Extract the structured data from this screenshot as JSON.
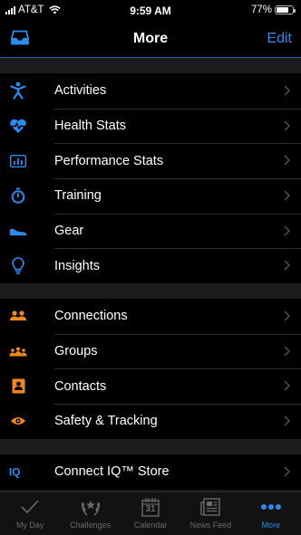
{
  "status_bar": {
    "carrier": "AT&T",
    "time": "9:59 AM",
    "battery": "77%",
    "battery_level": 0.77
  },
  "header": {
    "title": "More",
    "edit_label": "Edit"
  },
  "sections": [
    {
      "items": [
        {
          "label": "Activities",
          "icon": "figure-icon"
        },
        {
          "label": "Health Stats",
          "icon": "heart-pulse-icon"
        },
        {
          "label": "Performance Stats",
          "icon": "bar-chart-icon"
        },
        {
          "label": "Training",
          "icon": "stopwatch-icon"
        },
        {
          "label": "Gear",
          "icon": "shoe-icon"
        },
        {
          "label": "Insights",
          "icon": "lightbulb-icon"
        }
      ]
    },
    {
      "items": [
        {
          "label": "Connections",
          "icon": "people-icon"
        },
        {
          "label": "Groups",
          "icon": "group-icon"
        },
        {
          "label": "Contacts",
          "icon": "contact-card-icon"
        },
        {
          "label": "Safety & Tracking",
          "icon": "eye-icon"
        }
      ]
    },
    {
      "items": [
        {
          "label": "Connect IQ™ Store",
          "icon": "iq-icon"
        }
      ]
    }
  ],
  "tab_bar": {
    "tabs": [
      {
        "label": "My Day",
        "icon": "checkmark-icon",
        "active": false
      },
      {
        "label": "Challenges",
        "icon": "laurel-icon",
        "active": false
      },
      {
        "label": "Calendar",
        "icon": "calendar-icon",
        "active": false,
        "day": "31"
      },
      {
        "label": "News Feed",
        "icon": "newspaper-icon",
        "active": false
      },
      {
        "label": "More",
        "icon": "more-dots-icon",
        "active": true
      }
    ]
  },
  "colors": {
    "accent": "#2a8cf0",
    "section_one_icon": "#2a8cf0",
    "section_two_icon": "#f08a1c"
  }
}
